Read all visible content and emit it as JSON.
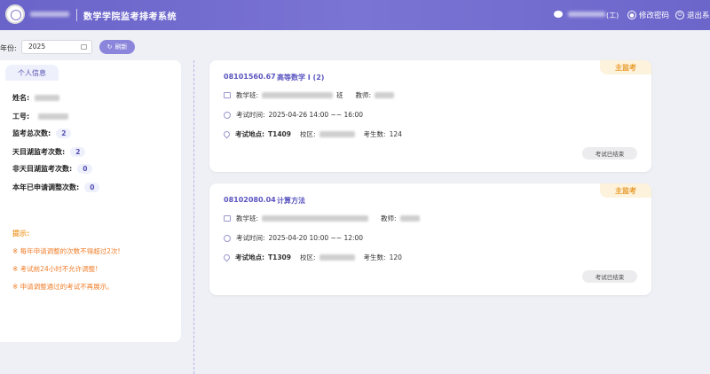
{
  "header": {
    "title": "数学学院监考排考系统",
    "user_suffix": "(工)",
    "change_password": "修改密码",
    "logout": "退出系"
  },
  "filter": {
    "label": "年份:",
    "year_value": "2025",
    "refresh_label": "刷新"
  },
  "sidebar": {
    "tab": "个人信息",
    "name_label": "姓名:",
    "id_label": "工号:",
    "total_label": "监考总次数:",
    "total_value": "2",
    "tianmu_label": "天目湖监考次数:",
    "tianmu_value": "2",
    "non_tianmu_label": "非天目湖监考次数:",
    "non_tianmu_value": "0",
    "adjust_label": "本年已申请调整次数:",
    "adjust_value": "0",
    "tips_title": "提示:",
    "tips": [
      "※ 每年申请调整的次数不得超过2次!",
      "※ 考试前24小时不允许调整!",
      "※ 申请调整通过的考试不再展示。"
    ]
  },
  "exams": [
    {
      "code": "08101560.67",
      "course": "高等数学 I (2)",
      "role": "主监考",
      "class_label": "教学班:",
      "class_suffix": "班",
      "teacher_label": "教师:",
      "time_label": "考试时间:",
      "time_value": "2025-04-26 14:00 ~~ 16:00",
      "location_label": "考试地点:",
      "location_value": "T1409",
      "campus_label": "校区:",
      "count_label": "考生数:",
      "count_value": "124",
      "status": "考试已结束"
    },
    {
      "code": "08102080.04",
      "course": "计算方法",
      "role": "主监考",
      "class_label": "教学班:",
      "class_suffix": "",
      "teacher_label": "教师:",
      "time_label": "考试时间:",
      "time_value": "2025-04-20 10:00 ~~ 12:00",
      "location_label": "考试地点:",
      "location_value": "T1309",
      "campus_label": "校区:",
      "count_label": "考生数:",
      "count_value": "120",
      "status": "考试已结束"
    }
  ]
}
